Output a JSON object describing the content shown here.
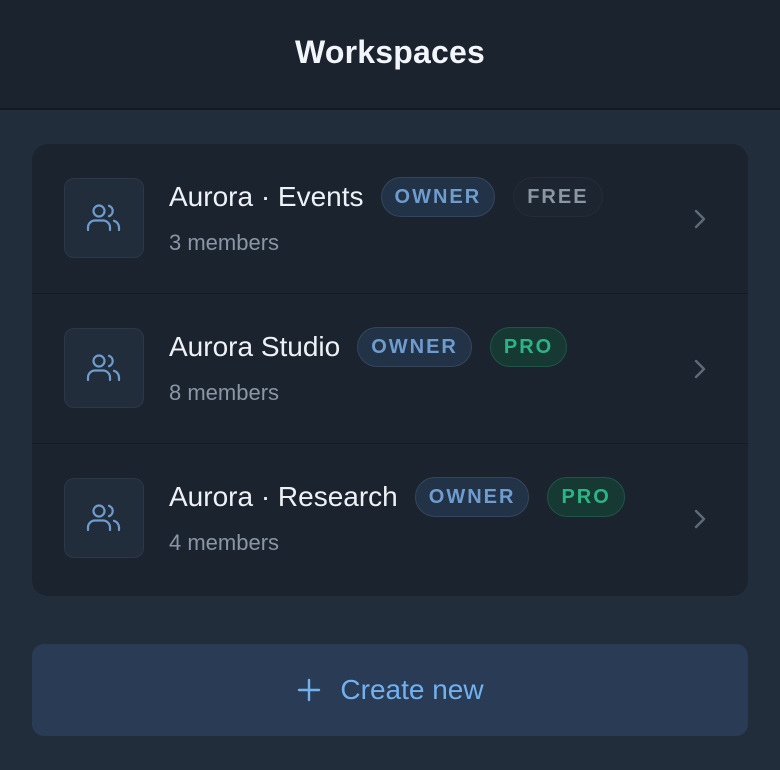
{
  "header": {
    "title": "Workspaces"
  },
  "workspaces": [
    {
      "name": "Aurora · Events",
      "role": "OWNER",
      "plan": "FREE",
      "members": "3 members"
    },
    {
      "name": "Aurora Studio",
      "role": "OWNER",
      "plan": "PRO",
      "members": "8 members"
    },
    {
      "name": "Aurora · Research",
      "role": "OWNER",
      "plan": "PRO",
      "members": "4 members"
    }
  ],
  "create_button": {
    "label": "Create new",
    "icon": "plus-icon"
  },
  "icons": {
    "workspace": "users-icon",
    "row_action": "chevron-right-icon"
  },
  "colors": {
    "accent": "#71b1ef",
    "owner_badge": "#6f9ccf",
    "pro_badge": "#2bb584",
    "free_badge": "#8b96a3"
  }
}
